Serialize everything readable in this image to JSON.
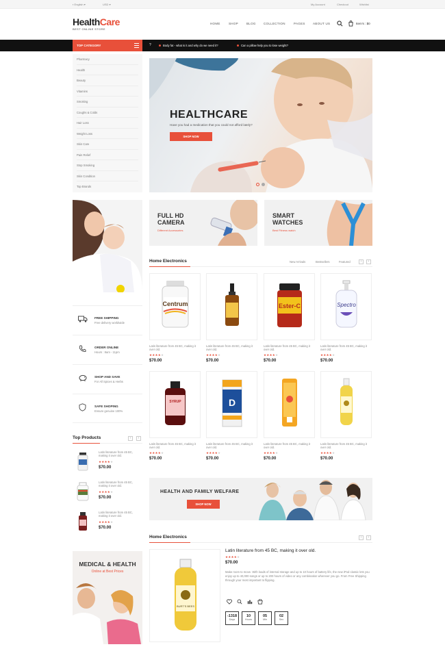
{
  "topbar": {
    "language": "English",
    "currency": "USD",
    "my_account": "My Account",
    "checkout": "Checkout",
    "wishlist": "Wishlist"
  },
  "header": {
    "logo_part1": "Health",
    "logo_part2": "Care",
    "tagline": "BEST ONLINE STORE",
    "cart_label": "Item's : $0"
  },
  "nav": [
    "HOME",
    "SHOP",
    "BLOG",
    "COLLECTION",
    "PAGES",
    "ABOUT US"
  ],
  "category": {
    "title": "TOP CATEGORY",
    "items": [
      "Pharmacy",
      "Health",
      "Beauty",
      "Vitamins",
      "Smoking",
      "Coughs & Colds",
      "Hair Loss",
      "Weight Loss",
      "Skin Care",
      "Pain Relief",
      "Stop Smoking",
      "Skin Condition",
      "Top Brands"
    ]
  },
  "ticker": {
    "item1": "Body fat - what is it and why do we need it?",
    "item2": "Can a pillow help you to lose weight?"
  },
  "hero": {
    "title": "HEALTHCARE",
    "subtitle": "Have you had a medication that you could not afford lately?",
    "button": "SHOP NOW",
    "slide_count": 2,
    "active_slide": 1
  },
  "banners": [
    {
      "title_line1": "FULL HD",
      "title_line2": "CAMERA",
      "subtitle": "Different Accessories"
    },
    {
      "title_line1": "SMART",
      "title_line2": "WATCHES",
      "subtitle": "Best Fitness watch"
    }
  ],
  "home_electronics": {
    "title": "Home Electronics",
    "tabs": [
      "New Arrivals",
      "Bestsellers",
      "Featured"
    ],
    "products": [
      {
        "name": "Latin literature from 45 BC, making it over old.",
        "rating": 4,
        "price": "$70.00",
        "image": "vitamin-bottle-white"
      },
      {
        "name": "Latin literature from 45 BC, making it over old.",
        "rating": 4,
        "price": "$70.00",
        "image": "dropper-bottle-amber"
      },
      {
        "name": "Latin literature from 45 BC, making it over old.",
        "rating": 4,
        "price": "$70.00",
        "image": "supplement-jar-red"
      },
      {
        "name": "Latin literature from 45 BC, making it over old.",
        "rating": 4,
        "price": "$70.00",
        "image": "pump-bottle-blue"
      },
      {
        "name": "Latin literature from 45 BC, making it over old.",
        "rating": 4,
        "price": "$70.00",
        "image": "syrup-bottle-pink"
      },
      {
        "name": "Latin literature from 45 BC, making it over old.",
        "rating": 4,
        "price": "$70.00",
        "image": "vitamin-d-box"
      },
      {
        "name": "Latin literature from 45 BC, making it over old.",
        "rating": 4,
        "price": "$70.00",
        "image": "tube-orange"
      },
      {
        "name": "Latin literature from 45 BC, making it over old.",
        "rating": 4,
        "price": "$70.00",
        "image": "oil-bottle-yellow"
      }
    ]
  },
  "services": [
    {
      "title": "FREE SHIPPING",
      "subtitle": "Free delivery worldwide",
      "icon": "truck-icon"
    },
    {
      "title": "ORDER ONLINE",
      "subtitle": "Hours : 8am - 11pm",
      "icon": "phone-icon"
    },
    {
      "title": "SHOP AND SAVE",
      "subtitle": "For All Spices & Herbs",
      "icon": "piggy-bank-icon"
    },
    {
      "title": "SAFE SHOPING",
      "subtitle": "Ensure genuine 100%",
      "icon": "shield-icon"
    }
  ],
  "top_products": {
    "title": "Top Products",
    "items": [
      {
        "name": "Latin literature from 45 BC, making it over old.",
        "rating": 4,
        "price": "$70.00"
      },
      {
        "name": "Latin literature from 45 BC, making it over old.",
        "rating": 4,
        "price": "$70.00"
      },
      {
        "name": "Latin literature from 45 BC, making it over old.",
        "rating": 4,
        "price": "$70.00"
      }
    ]
  },
  "welfare_banner": {
    "title": "HEALTH AND FAMILY WELFARE",
    "button": "SHOP NOW"
  },
  "medical_banner": {
    "title": "MEDICAL & HEALTH",
    "subtitle": "Online at Best Prices"
  },
  "deal": {
    "section_title": "Home Electronics",
    "product_name": "Latin literature from 45 BC, making it over old.",
    "rating": 4,
    "price": "$70.00",
    "description": "Make room to move. With loads of internal storage and up to 10 hours of battery life, the new iPod classic lets you enjoy up to 40,000 songs or up to 200 hours of video or any combination wherever you go. From Free Shipping through your most important to flipping.",
    "countdown": [
      {
        "value": "-1318",
        "label": "Days"
      },
      {
        "value": "10",
        "label": "Hours"
      },
      {
        "value": "05",
        "label": "Min"
      },
      {
        "value": "02",
        "label": "Sec"
      }
    ]
  },
  "colors": {
    "accent": "#e8503a",
    "dark": "#111111"
  }
}
